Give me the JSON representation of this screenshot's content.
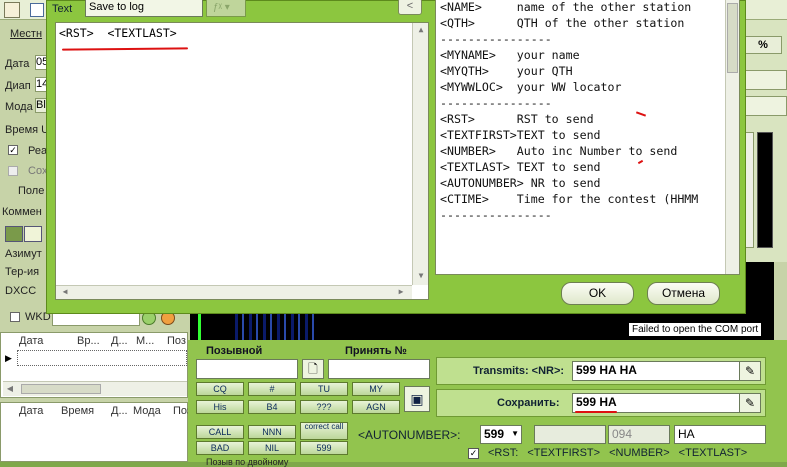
{
  "dialog": {
    "text_label": "Text",
    "save_select": "Save to log",
    "back_icon": "<",
    "textarea_value": "<RST>  <TEXTLAST>",
    "help_lines": [
      "<NAME>     name of the other station",
      "<QTH>      QTH of the other station",
      "----------------",
      "<MYNAME>   your name",
      "<MYQTH>    your QTH",
      "<MYWWLOC>  your WW locator",
      "----------------",
      "<RST>      RST to send",
      "<TEXTFIRST>TEXT to send",
      "<NUMBER>   Auto inc Number to send",
      "<TEXTLAST> TEXT to send",
      "<AUTONUMBER> NR to send",
      "<CTIME>    Time for the contest (HHMM",
      "----------------"
    ],
    "ok_label": "OK",
    "cancel_label": "Отмена"
  },
  "left": {
    "local_label": "Местн",
    "date_label": "Дата",
    "date_value": "05",
    "band_label": "Диап",
    "band_value": "14",
    "mode_label": "Мода",
    "mode_value": "Bl",
    "time_label": "Время U",
    "real_label": "Реа",
    "save_label": "Сох",
    "field_label": "Поле",
    "comment_label": "Коммен",
    "azimuth_label": "Азимут",
    "territory_label": "Тер-ия",
    "dxcc_label": "DXCC",
    "wkd_label": "WKD",
    "grid1_headers": [
      "Дата",
      "Вр...",
      "Д...",
      "М...",
      "Поз"
    ],
    "grid2_headers": [
      "Дата",
      "Время",
      "Д...",
      "Мода",
      "Поз"
    ]
  },
  "top": {
    "percent": "%"
  },
  "logger": {
    "callsign_label": "Позывной",
    "received_label": "Принять №",
    "com_error": "Failed to open the COM port",
    "macro_buttons": [
      "CQ",
      "#",
      "TU",
      "MY",
      "His",
      "B4",
      "???",
      "AGN"
    ],
    "call_buttons": [
      "CALL",
      "NNN",
      "correct call",
      "BAD",
      "NIL",
      "599"
    ],
    "transmits_label": "Transmits: <NR>:",
    "transmits_value": "599 HA HA",
    "save_label": "Сохранить:",
    "save_value": "599 HA",
    "autonumber_label": "<AUTONUMBER>:",
    "autonumber_value": "599",
    "number_value": "094",
    "textlast_value": "HA",
    "bottom_fields": "<RST:  <TEXTFIRST>  <NUMBER>  <TEXTLAST>",
    "bottom_truncated": "Позыв по двойному"
  }
}
